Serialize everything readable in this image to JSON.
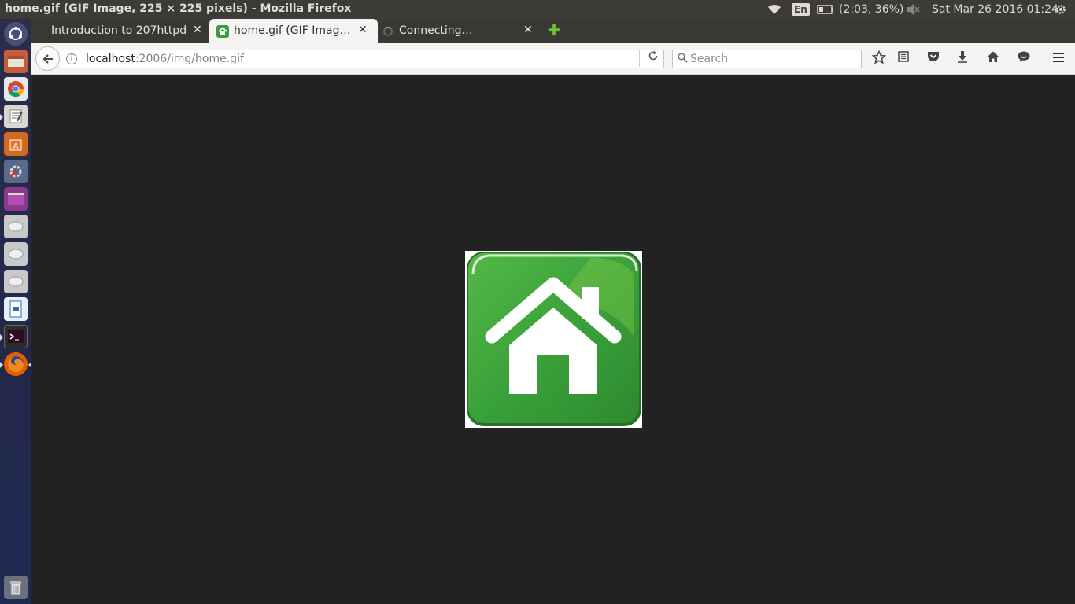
{
  "window": {
    "title": "home.gif (GIF Image, 225 × 225 pixels) - Mozilla Firefox"
  },
  "tray": {
    "language": "En",
    "battery": "(2:03, 36%)",
    "clock": "Sat Mar 26 2016 01:24"
  },
  "tabs": [
    {
      "label": "Introduction to 207httpd"
    },
    {
      "label": "home.gif (GIF Image, 225 × 225 pixels)"
    },
    {
      "label": "Connecting…"
    }
  ],
  "nav": {
    "url_host": "localhost",
    "url_path": ":2006/img/home.gif",
    "search_placeholder": "Search"
  },
  "colors": {
    "panel": "#3c3b37",
    "toolbar": "#f5f4f2",
    "content_bg": "#222222",
    "home_green": "#3a9e3a"
  },
  "launcher_icons": [
    "ubuntu-dash-icon",
    "files-icon",
    "chrome-icon",
    "text-editor-icon",
    "software-center-icon",
    "system-settings-icon",
    "workspace-icon",
    "drive-icon",
    "drive-icon",
    "drive-icon",
    "libreoffice-writer-icon",
    "terminal-icon",
    "firefox-icon",
    "trash-icon"
  ]
}
